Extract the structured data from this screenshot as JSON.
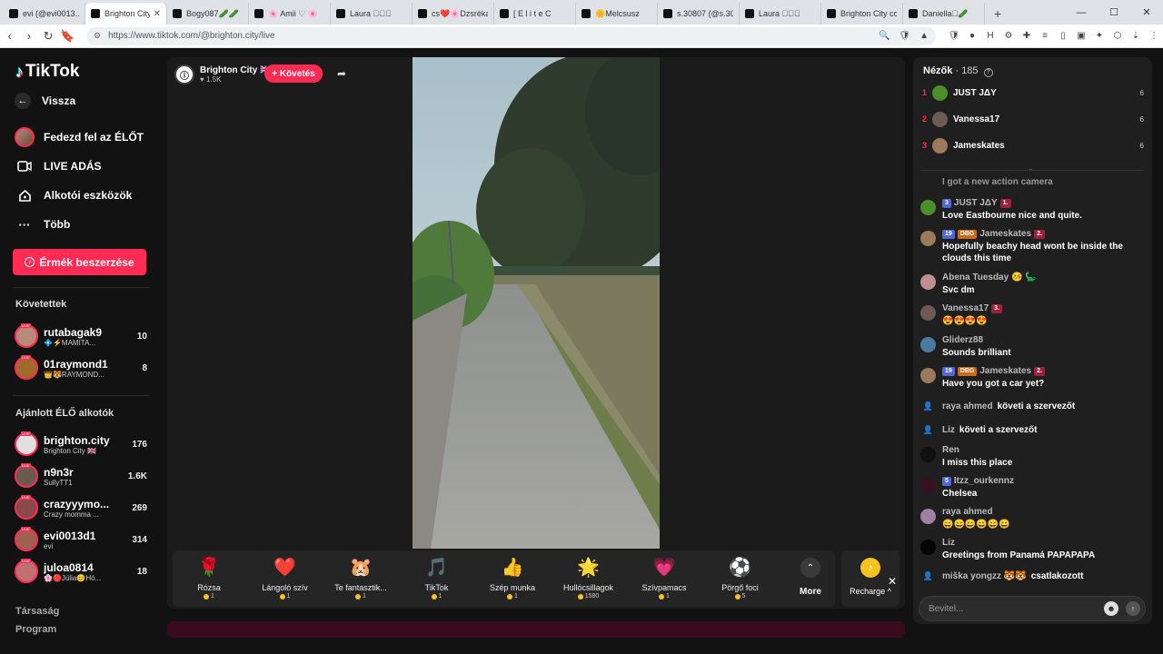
{
  "browser": {
    "tabs": [
      {
        "label": "evi (@evi0013...",
        "active": false
      },
      {
        "label": "Brighton City",
        "active": true
      },
      {
        "label": "Bogy087🥒🥒",
        "active": false
      },
      {
        "label": "🌸 Amii ♡ 🌸",
        "active": false
      },
      {
        "label": "Laura 🏻🏻🏻",
        "active": false
      },
      {
        "label": "cs❤️🌸Dzsréka❤️",
        "active": false
      },
      {
        "label": "[ E l i t e C",
        "active": false
      },
      {
        "label": "🌼Melcsusz",
        "active": false
      },
      {
        "label": "s.30807 (@s.30",
        "active": false
      },
      {
        "label": "Laura 🏻🏻🏻",
        "active": false
      },
      {
        "label": "Brighton City co",
        "active": false
      },
      {
        "label": "Daniella🏻🥒",
        "active": false
      }
    ],
    "new_tab": "+",
    "url": "https://www.tiktok.com/@brighton.city/live"
  },
  "sidebar": {
    "logo_text": "TikTok",
    "back": "Vissza",
    "explore_live": "Fedezd fel az ÉLŐT",
    "live_broadcast": "LIVE ADÁS",
    "creator_tools": "Alkotói eszközök",
    "more": "Több",
    "buy_coins": "Érmék beszerzése",
    "following_title": "Követettek",
    "following": [
      {
        "name": "rutabagak9",
        "sub": "💠⚡MAMITA...",
        "count": "10"
      },
      {
        "name": "01raymond1",
        "sub": "👑🐯RAYMOND...",
        "count": "8"
      }
    ],
    "recommended_title": "Ajánlott ÉLŐ alkotók",
    "recommended": [
      {
        "name": "brighton.city",
        "sub": "Brighton City 🇬🇧",
        "count": "176"
      },
      {
        "name": "n9n3r",
        "sub": "SullyTT1",
        "count": "1.6K"
      },
      {
        "name": "crazyyymo...",
        "sub": "Crazy momma ...",
        "count": "269"
      },
      {
        "name": "evi0013d1",
        "sub": "evi",
        "count": "314"
      },
      {
        "name": "juloa0814",
        "sub": "🌸🔴Júlia😊Hó...",
        "count": "18"
      }
    ],
    "footer_links": [
      "Társaság",
      "Program"
    ],
    "live_tag": "LIVE"
  },
  "stream": {
    "host_name": "Brighton City 🇬🇧",
    "host_likes": "♥ 1.5K",
    "follow_label": "+ Követés",
    "gifts": [
      {
        "name": "Rózsa",
        "price": "1",
        "icon": "🌹"
      },
      {
        "name": "Lángoló szív",
        "price": "1",
        "icon": "❤️"
      },
      {
        "name": "Te fantasztik...",
        "price": "1",
        "icon": "🐹"
      },
      {
        "name": "TikTok",
        "price": "1",
        "icon": "🎵"
      },
      {
        "name": "Szép munka",
        "price": "1",
        "icon": "👍"
      },
      {
        "name": "Hullócsillagok",
        "price": "1580",
        "icon": "🌟"
      },
      {
        "name": "Szívpamacs",
        "price": "1",
        "icon": "💗"
      },
      {
        "name": "Pörgő foci",
        "price": "5",
        "icon": "⚽"
      }
    ],
    "more_label": "More",
    "recharge_label": "Recharge ^"
  },
  "chat": {
    "viewers_label": "Nézők",
    "viewers_count": "· 185",
    "top_viewers": [
      {
        "rank": "1",
        "name": "JUST JΔY",
        "score": "6",
        "color": "#4a8f2a"
      },
      {
        "rank": "2",
        "name": "Vanessa17",
        "score": "6",
        "color": "#6b5a55"
      },
      {
        "rank": "3",
        "name": "Jameskates",
        "score": "6",
        "color": "#9a7a5a"
      }
    ],
    "messages": [
      {
        "name": "",
        "text": "I got a new action camera",
        "faded": true
      },
      {
        "name": "JUST JΔY",
        "lvl": "3",
        "rank": "1.",
        "text": "Love Eastbourne nice and quite.",
        "color": "#4a8f2a"
      },
      {
        "name": "Jameskates",
        "lvl": "19",
        "dbg": "DBG",
        "rank": "2.",
        "text": "Hopefully beachy head wont be inside the clouds this time",
        "color": "#9a7a5a"
      },
      {
        "name": "Abena Tuesday 🤒 🦕",
        "text": "Svc dm",
        "color": "#c09090"
      },
      {
        "name": "Vanessa17",
        "rank": "3.",
        "text": "😍😍😍😍",
        "color": "#6b5a55"
      },
      {
        "name": "Gliderz88",
        "text": "Sounds brilliant",
        "color": "#4a7aa0"
      },
      {
        "name": "Jameskates",
        "lvl": "19",
        "dbg": "DBG",
        "rank": "2.",
        "text": "Have you got a car yet?",
        "color": "#9a7a5a"
      },
      {
        "name": "raya ahmed",
        "text": "követi a szervezőt",
        "system": true
      },
      {
        "name": "Liz",
        "text": "követi a szervezőt",
        "system": true
      },
      {
        "name": "Ren",
        "text": "I miss this place",
        "color": "#111111"
      },
      {
        "name": "Itzz_ourkennz",
        "lvl": "5",
        "text": "Chelsea",
        "color": "#3a1020"
      },
      {
        "name": "raya ahmed",
        "text": "😄😄😄😄😄😄",
        "color": "#a080a0"
      },
      {
        "name": "Liz",
        "text": "Greetings from Panamá PAPAPAPA",
        "color": "#050505"
      },
      {
        "name": "miška yongzz 🐯🐯",
        "text": "csatlakozott",
        "system": true
      }
    ],
    "input_placeholder": "Bevitel..."
  }
}
